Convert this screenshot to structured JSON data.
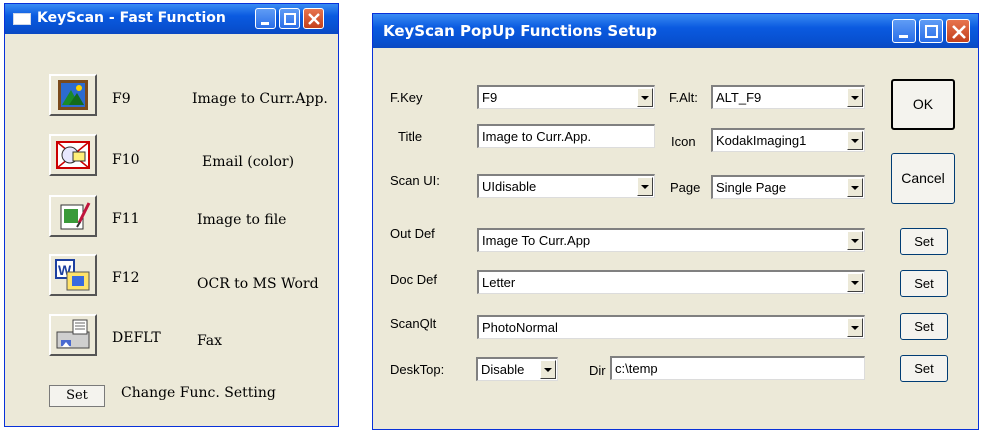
{
  "fast_window": {
    "title": "KeyScan - Fast Function",
    "functions": [
      {
        "key": "F9",
        "desc": "Image to Curr.App.",
        "icon": "image-to-app-icon"
      },
      {
        "key": "F10",
        "desc": "Email (color)",
        "icon": "email-icon"
      },
      {
        "key": "F11",
        "desc": "Image to file",
        "icon": "image-to-file-icon"
      },
      {
        "key": "F12",
        "desc": "OCR to MS Word",
        "icon": "ocr-word-icon"
      },
      {
        "key": "DEFLT",
        "desc": "Fax",
        "icon": "fax-icon"
      }
    ],
    "set_label": "Set",
    "change_label": "Change Func. Setting"
  },
  "setup_window": {
    "title": "KeyScan PopUp Functions Setup",
    "fkey": {
      "label": "F.Key",
      "value": "F9"
    },
    "falt": {
      "label": "F.Alt:",
      "value": "ALT_F9"
    },
    "title_field": {
      "label": "Title",
      "value": "Image to Curr.App."
    },
    "icon_field": {
      "label": "Icon",
      "value": "KodakImaging1"
    },
    "scan_ui": {
      "label": "Scan UI:",
      "value": "UIdisable"
    },
    "page": {
      "label": "Page",
      "value": "Single Page"
    },
    "out_def": {
      "label": "Out Def",
      "value": "Image To Curr.App"
    },
    "doc_def": {
      "label": "Doc Def",
      "value": "Letter"
    },
    "scan_qlt": {
      "label": "ScanQlt",
      "value": "PhotoNormal"
    },
    "desktop": {
      "label": "DeskTop:",
      "value": "Disable"
    },
    "dir": {
      "label": "Dir",
      "value": "c:\\temp"
    },
    "ok_label": "OK",
    "cancel_label": "Cancel",
    "set_label": "Set"
  },
  "colors": {
    "titlebar": "#0a5ae0",
    "window_bg": "#ece9d8",
    "close": "#c3401c"
  }
}
